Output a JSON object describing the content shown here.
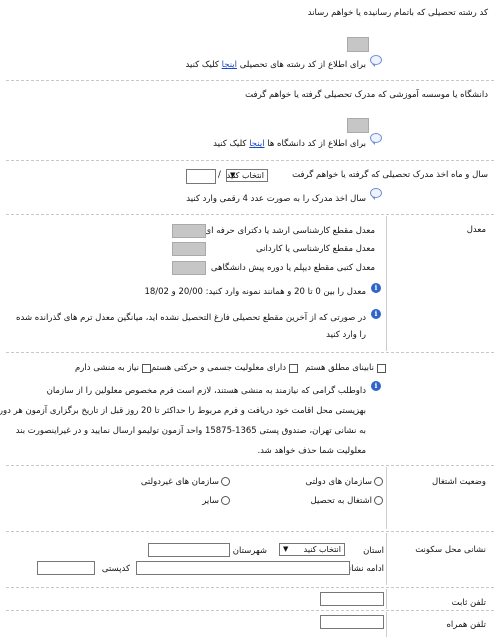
{
  "major": {
    "question": "کد رشته تحصیلی که باتمام رسانیده یا خواهم رساند",
    "help_prefix": "برای اطلاع از کد رشته های تحصیلی",
    "help_link": "اینجا",
    "help_suffix": "کلیک کنید"
  },
  "university": {
    "question": "دانشگاه یا موسسه آموزشی که مدرک تحصیلی گرفته یا خواهم گرفت",
    "help_prefix": "برای اطلاع از کد دانشگاه ها",
    "help_link": "اینجا",
    "help_suffix": "کلیک کنید"
  },
  "degree_date": {
    "question": "سال و ماه اخذ مدرک تحصیلی که گرفته یا خواهم گرفت",
    "month_selected": "انتخاب کنید",
    "slash": "/",
    "hint": "سال اخذ مدرک را به صورت عدد 4 رقمی وارد کنید"
  },
  "gpa": {
    "section_label": "معدل",
    "rows": [
      {
        "label": "معدل مقطع کارشناسی ارشد یا دکترای حرفه ای"
      },
      {
        "label": "معدل مقطع کارشناسی یا کاردانی"
      },
      {
        "label": "معدل کتبی مقطع دیپلم یا دوره پیش دانشگاهی"
      }
    ],
    "note1": "معدل را بین 0 تا 20 و همانند نمونه وارد کنید: 20/00 و 18/02",
    "note2_line1": "در صورتی که از آخرین مقطع تحصیلی فارغ التحصیل نشده اید، میانگین معدل ترم های گذرانده شده",
    "note2_line2": "را وارد کنید"
  },
  "disability": {
    "options": [
      "نابینای مطلق هستم",
      "دارای معلولیت جسمی و حرکتی هستم",
      "نیاز به منشی دارم"
    ],
    "note_lines": [
      "داوطلب گرامی که نیازمند به منشی هستند، لازم است فرم مخصوص معلولین را از سازمان",
      "بهزیستی محل اقامت خود دریافت و فرم مربوط را حداکثر تا 20 روز قبل از تاریخ برگزاری آزمون هر دوره",
      "به نشانی تهران، صندوق پستی 1365-15875 واحد آزمون تولیمو ارسال نمایید و در غیراینصورت بند",
      "معلولیت شما حذف خواهد شد."
    ]
  },
  "employment": {
    "label": "وضعیت اشتغال",
    "options": [
      "سازمان های دولتی",
      "سازمان های غیردولتی",
      "اشتغال به تحصیل",
      "سایر"
    ]
  },
  "address": {
    "label": "نشانی محل سکونت",
    "province_label": "استان",
    "province_selected": "انتخاب کنید",
    "city_label": "شهرستان",
    "rest_label": "ادامه نشانی",
    "postal_label": "کدپستی"
  },
  "phone": {
    "label": "تلفن ثابت"
  },
  "mobile": {
    "label": "تلفن همراه"
  }
}
